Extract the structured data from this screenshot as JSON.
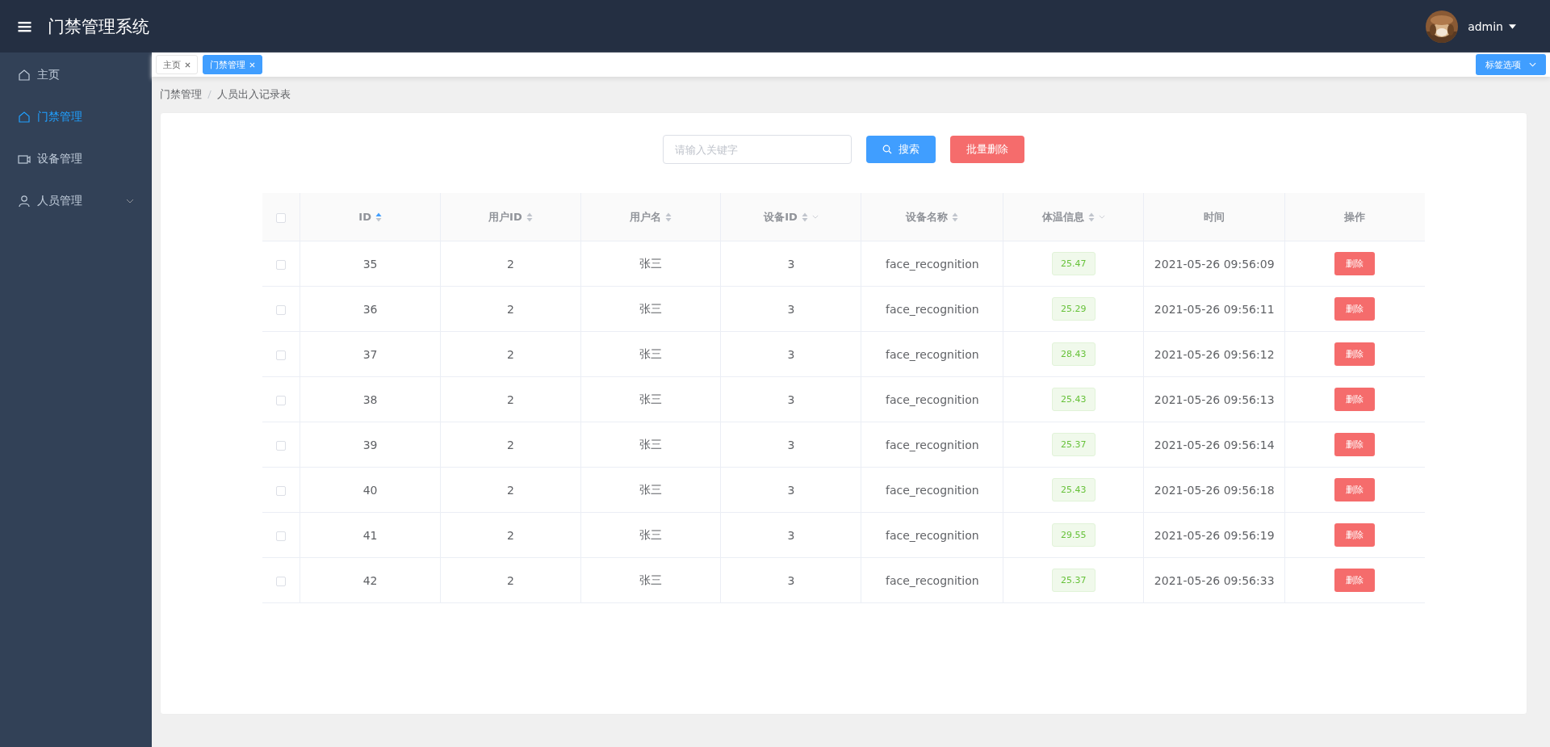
{
  "header": {
    "title": "门禁管理系统",
    "user": "admin"
  },
  "sidebar": {
    "items": [
      {
        "label": "主页",
        "kind": "home",
        "selected": false
      },
      {
        "label": "门禁管理",
        "kind": "home",
        "selected": true
      },
      {
        "label": "设备管理",
        "kind": "device",
        "selected": false
      },
      {
        "label": "人员管理",
        "kind": "person",
        "selected": false,
        "expanded": false
      }
    ]
  },
  "tabs": [
    {
      "label": "主页",
      "selected": false
    },
    {
      "label": "门禁管理",
      "selected": true
    }
  ],
  "tab_options": "标签选项",
  "breadcrumb": [
    "门禁管理",
    "人员出入记录表"
  ],
  "search": {
    "placeholder": "请输入关键字",
    "button": "搜索",
    "batch_delete": "批量删除"
  },
  "table": {
    "select_all_checked": false,
    "columns": [
      {
        "label": "ID",
        "sortable": true,
        "sorted_ascending": true,
        "filter": false
      },
      {
        "label": "用户ID",
        "sortable": true,
        "sorted_ascending": false,
        "filter": false
      },
      {
        "label": "用户名",
        "sortable": true,
        "sorted_ascending": false,
        "filter": false
      },
      {
        "label": "设备ID",
        "sortable": true,
        "sorted_ascending": false,
        "filter": true
      },
      {
        "label": "设备名称",
        "sortable": true,
        "sorted_ascending": false,
        "filter": false
      },
      {
        "label": "体温信息",
        "sortable": true,
        "sorted_ascending": false,
        "filter": true
      },
      {
        "label": "时间"
      },
      {
        "label": "操作"
      }
    ],
    "rows": [
      {
        "checked": false,
        "cells": [
          "35",
          "2",
          "张三",
          "3",
          "face_recognition",
          "25.47",
          "2021-05-26 09:56:09"
        ],
        "action": "删除"
      },
      {
        "checked": false,
        "cells": [
          "36",
          "2",
          "张三",
          "3",
          "face_recognition",
          "25.29",
          "2021-05-26 09:56:11"
        ],
        "action": "删除"
      },
      {
        "checked": false,
        "cells": [
          "37",
          "2",
          "张三",
          "3",
          "face_recognition",
          "28.43",
          "2021-05-26 09:56:12"
        ],
        "action": "删除"
      },
      {
        "checked": false,
        "cells": [
          "38",
          "2",
          "张三",
          "3",
          "face_recognition",
          "25.43",
          "2021-05-26 09:56:13"
        ],
        "action": "删除"
      },
      {
        "checked": false,
        "cells": [
          "39",
          "2",
          "张三",
          "3",
          "face_recognition",
          "25.37",
          "2021-05-26 09:56:14"
        ],
        "action": "删除"
      },
      {
        "checked": false,
        "cells": [
          "40",
          "2",
          "张三",
          "3",
          "face_recognition",
          "25.43",
          "2021-05-26 09:56:18"
        ],
        "action": "删除"
      },
      {
        "checked": false,
        "cells": [
          "41",
          "2",
          "张三",
          "3",
          "face_recognition",
          "29.55",
          "2021-05-26 09:56:19"
        ],
        "action": "删除"
      },
      {
        "checked": false,
        "cells": [
          "42",
          "2",
          "张三",
          "3",
          "face_recognition",
          "25.37",
          "2021-05-26 09:56:33"
        ],
        "action": "删除"
      }
    ]
  }
}
